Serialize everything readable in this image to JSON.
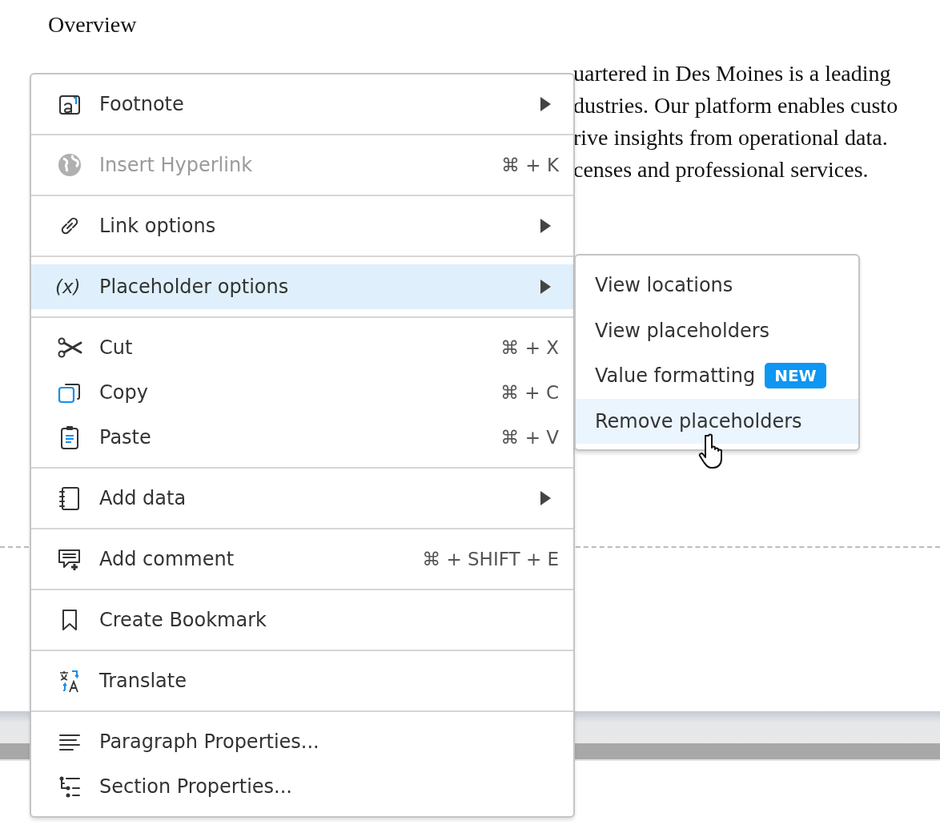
{
  "document": {
    "heading": "Overview",
    "lines": [
      "uartered in Des Moines is a leading",
      "dustries. Our platform enables custo",
      "rive insights from operational data.",
      "censes and professional services."
    ]
  },
  "context_menu": {
    "groups": [
      {
        "items": [
          {
            "label": "Footnote",
            "has_submenu": true,
            "disabled": false,
            "selected": false
          }
        ]
      },
      {
        "items": [
          {
            "label": "Insert Hyperlink",
            "shortcut": "⌘ + K",
            "has_submenu": false,
            "disabled": true,
            "selected": false
          }
        ]
      },
      {
        "items": [
          {
            "label": "Link options",
            "has_submenu": true,
            "disabled": false,
            "selected": false
          }
        ]
      },
      {
        "items": [
          {
            "label": "Placeholder options",
            "icon_text": "(x)",
            "has_submenu": true,
            "disabled": false,
            "selected": true
          }
        ]
      },
      {
        "items": [
          {
            "label": "Cut",
            "shortcut": "⌘ + X",
            "has_submenu": false,
            "disabled": false,
            "selected": false
          },
          {
            "label": "Copy",
            "shortcut": "⌘ + C",
            "has_submenu": false,
            "disabled": false,
            "selected": false
          },
          {
            "label": "Paste",
            "shortcut": "⌘ + V",
            "has_submenu": false,
            "disabled": false,
            "selected": false
          }
        ]
      },
      {
        "items": [
          {
            "label": "Add data",
            "has_submenu": true,
            "disabled": false,
            "selected": false
          }
        ]
      },
      {
        "items": [
          {
            "label": "Add comment",
            "shortcut": "⌘ + SHIFT + E",
            "has_submenu": false,
            "disabled": false,
            "selected": false
          }
        ]
      },
      {
        "items": [
          {
            "label": "Create Bookmark",
            "has_submenu": false,
            "disabled": false,
            "selected": false
          }
        ]
      },
      {
        "items": [
          {
            "label": "Translate",
            "has_submenu": false,
            "disabled": false,
            "selected": false
          }
        ]
      },
      {
        "items": [
          {
            "label": "Paragraph Properties...",
            "has_submenu": false,
            "disabled": false,
            "selected": false
          },
          {
            "label": "Section Properties...",
            "has_submenu": false,
            "disabled": false,
            "selected": false
          }
        ]
      }
    ]
  },
  "submenu": {
    "items": [
      {
        "label": "View locations",
        "selected": false
      },
      {
        "label": "View placeholders",
        "selected": false
      },
      {
        "label": "Value formatting",
        "badge": "NEW",
        "selected": false
      },
      {
        "label": "Remove placeholders",
        "selected": true
      }
    ]
  }
}
